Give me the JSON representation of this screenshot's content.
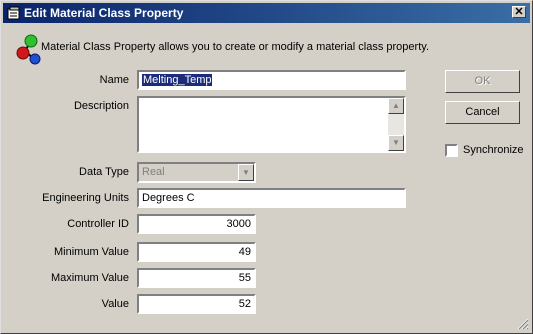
{
  "window": {
    "title": "Edit Material Class Property",
    "close_glyph": "✕"
  },
  "info": {
    "icon": "material-molecule-icon",
    "text": "Material Class Property allows you to create or modify a material class property."
  },
  "form": {
    "name_label": "Name",
    "name_value": "Melting_Temp",
    "description_label": "Description",
    "description_value": "",
    "data_type_label": "Data Type",
    "data_type_value": "Real",
    "engineering_units_label": "Engineering Units",
    "engineering_units_value": "Degrees C",
    "controller_id_label": "Controller ID",
    "controller_id_value": "3000",
    "minimum_value_label": "Minimum Value",
    "minimum_value": "49",
    "maximum_value_label": "Maximum Value",
    "maximum_value": "55",
    "value_label": "Value",
    "value": "52"
  },
  "buttons": {
    "ok_label": "OK",
    "cancel_label": "Cancel"
  },
  "synchronize": {
    "label": "Synchronize",
    "checked": false
  },
  "colors": {
    "title_start": "#0a246a",
    "title_end": "#3a6ea5",
    "face": "#d4d0c8",
    "selection": "#1c2c7a"
  }
}
